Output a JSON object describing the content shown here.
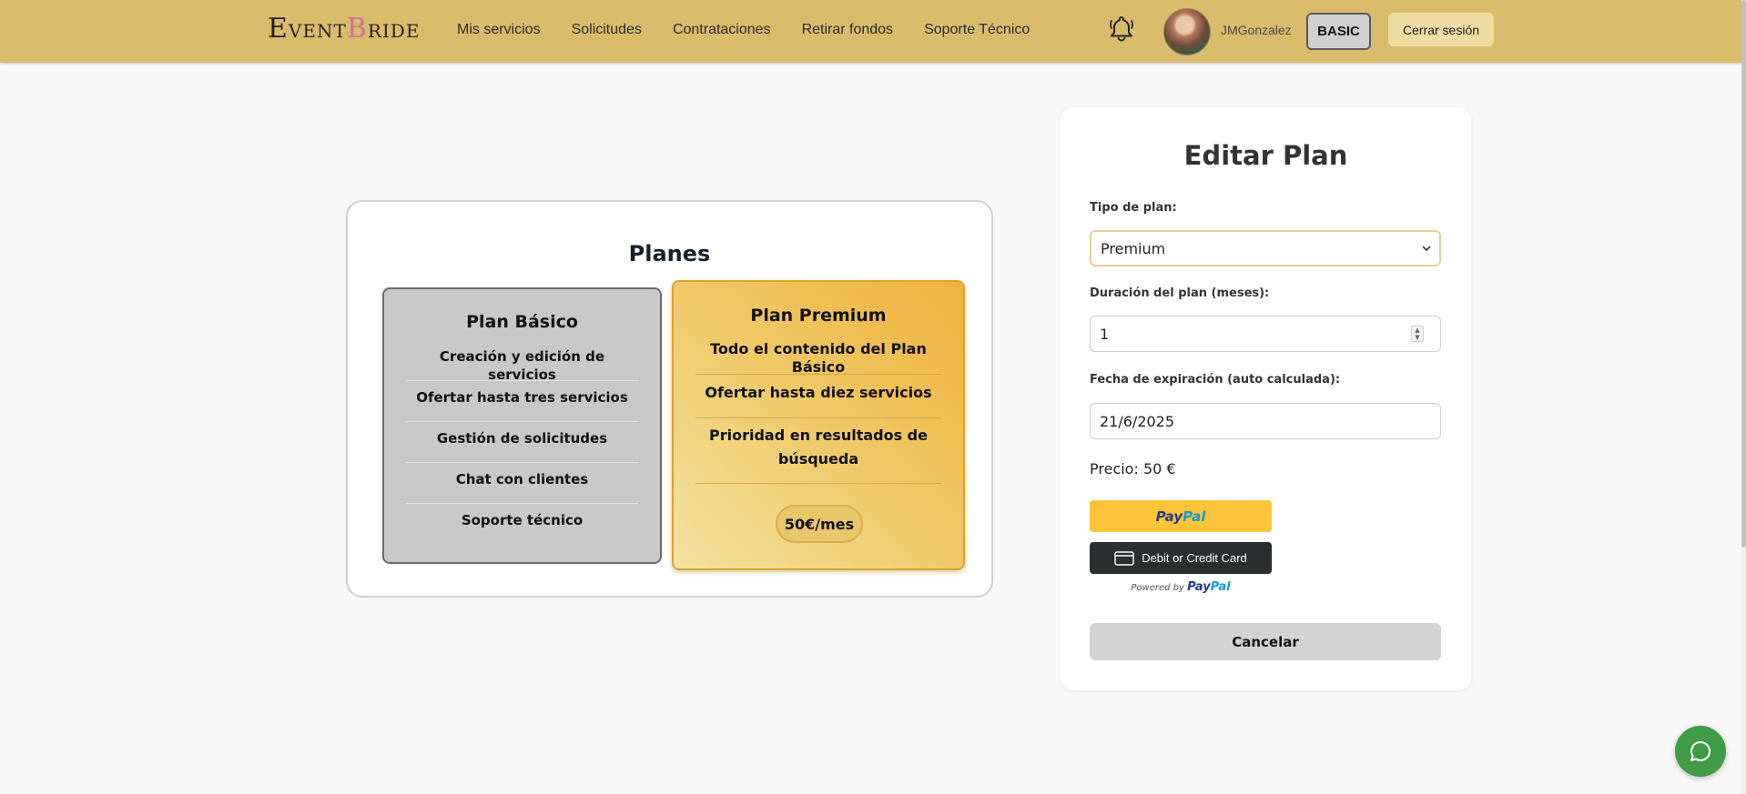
{
  "header": {
    "logo": {
      "e": "E",
      "vent": "VENT",
      "b": "B",
      "ride": "RIDE"
    },
    "nav": [
      "Mis servicios",
      "Solicitudes",
      "Contrataciones",
      "Retirar fondos",
      "Soporte Técnico"
    ],
    "username": "JMGonzalez",
    "plan_badge": "BASIC",
    "logout_label": "Cerrar sesión"
  },
  "plans": {
    "title": "Planes",
    "basic": {
      "name": "Plan Básico",
      "features": [
        "Creación y edición de servicios",
        "Ofertar hasta tres servicios",
        "Gestión de solicitudes",
        "Chat con clientes",
        "Soporte técnico"
      ]
    },
    "premium": {
      "name": "Plan Premium",
      "features": [
        "Todo el contenido del Plan Básico",
        "Ofertar hasta diez servicios",
        "Prioridad en resultados de búsqueda"
      ],
      "price": "50€/mes"
    }
  },
  "edit": {
    "title": "Editar Plan",
    "plan_type_label": "Tipo de plan:",
    "plan_type_value": "Premium",
    "duration_label": "Duración del plan (meses):",
    "duration_value": "1",
    "expiry_label": "Fecha de expiración (auto calculada):",
    "expiry_value": "21/6/2025",
    "price_text": "Precio: 50 €",
    "paypal": {
      "pay": "Pay",
      "pal": "Pal"
    },
    "card_button": "Debit or Credit Card",
    "powered_by": "Powered by",
    "cancel_label": "Cancelar"
  },
  "colors": {
    "header_bg": "#d9bc6b",
    "premium_accent": "#efb23f",
    "chat_green": "#3f9b45",
    "paypal_yellow": "#ffc439"
  }
}
